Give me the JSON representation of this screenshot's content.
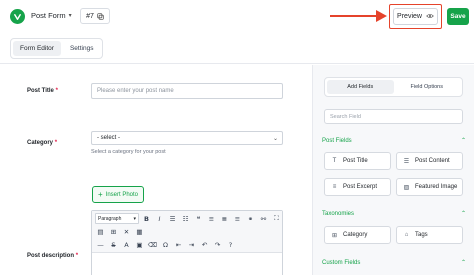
{
  "header": {
    "form_name": "Post Form",
    "form_id": "#7",
    "preview_label": "Preview",
    "save_label": "Save",
    "accent_color": "#16a34a",
    "highlight_color": "#e5432b"
  },
  "tabs": [
    {
      "label": "Form Editor",
      "active": true
    },
    {
      "label": "Settings",
      "active": false
    }
  ],
  "editor": {
    "post_title": {
      "label": "Post Title",
      "required": "*",
      "placeholder": "Please enter your post name"
    },
    "category": {
      "label": "Category",
      "required": "*",
      "value": "- select -",
      "helper": "Select a category for your post"
    },
    "insert_photo_label": "Insert Photo",
    "post_description": {
      "label": "Post description",
      "required": "*",
      "format_value": "Paragraph"
    }
  },
  "panel": {
    "tabs": [
      {
        "label": "Add Fields",
        "active": true
      },
      {
        "label": "Field Options",
        "active": false
      }
    ],
    "search_placeholder": "Search Field",
    "sections": {
      "post_fields": {
        "title": "Post Fields",
        "items": [
          "Post Title",
          "Post Content",
          "Post Excerpt",
          "Featured Image"
        ]
      },
      "taxonomies": {
        "title": "Taxonomies",
        "items": [
          "Category",
          "Tags"
        ]
      },
      "custom_fields": {
        "title": "Custom Fields"
      }
    }
  }
}
